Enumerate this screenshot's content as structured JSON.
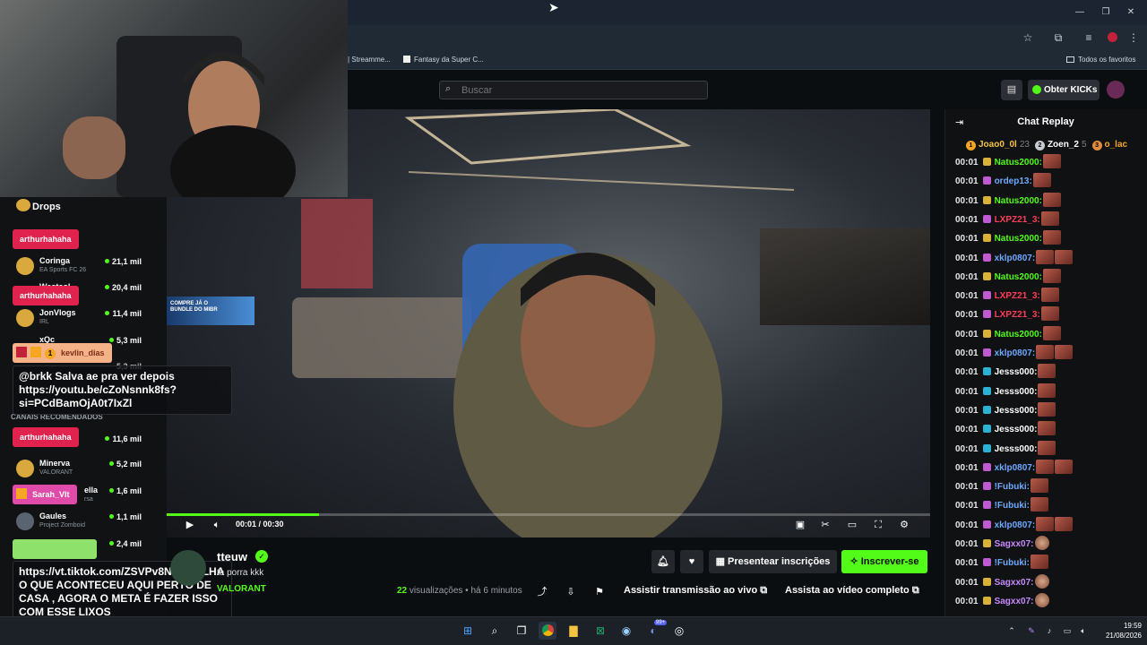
{
  "browser": {
    "bookmarks": [
      {
        "label": "| Streamme..."
      },
      {
        "label": "Fantasy da Super C..."
      }
    ],
    "bookmarks_folder": "Todos os favoritos"
  },
  "header": {
    "search_placeholder": "Buscar",
    "kicks_button": "Obter KICKs"
  },
  "sidebar": {
    "drops_label": "Drops",
    "section_recommended": "CANAIS RECOMENDADOS",
    "channels": [
      {
        "name": "Coringa",
        "category": "EA Sports FC 26",
        "viewers": "21,1 mil"
      },
      {
        "name": "Westcol",
        "category": "",
        "viewers": "20,4 mil"
      },
      {
        "name": "JonVlogs",
        "category": "IRL",
        "viewers": "11,4 mil"
      },
      {
        "name": "xQc",
        "category": "",
        "viewers": "5,3 mil"
      },
      {
        "name": "",
        "category": "",
        "viewers": "5,3 mil"
      },
      {
        "name": "",
        "category": "",
        "viewers": "11,6 mil"
      },
      {
        "name": "Minerva",
        "category": "VALORANT",
        "viewers": "5,2 mil"
      },
      {
        "name": "ella",
        "category": "rsa",
        "viewers": "1,6 mil"
      },
      {
        "name": "Gaules",
        "category": "Project Zomboid",
        "viewers": "1,1 mil"
      },
      {
        "name": "",
        "category": "",
        "viewers": "2,4 mil"
      }
    ]
  },
  "overlay": {
    "tag1": "arthurhahaha",
    "tag2": "arthurhahaha",
    "tag3": "kevlin_dias",
    "tag3_badge": "1",
    "msg1": "@brkk Salva ae pra ver depois https://youtu.be/cZoNsnnk8fs?si=PCdBamOjA0t7IxZl",
    "tag4": "arthurhahaha",
    "tag5": "Sarah_Vlt",
    "msg2": "https://vt.tiktok.com/ZSVPv8NQN/ OLHA O QUE ACONTECEU AQUI PERTO DE CASA , AGORA O META É FAZER ISSO COM ESSE LIXOS",
    "banner": "COMPRE JÁ O BUNDLE DO MIBR"
  },
  "video": {
    "timecode": "00:01 / 00:30",
    "progress_fraction": 0.2
  },
  "info": {
    "channel": "tteuw",
    "title": "ta porra kkk",
    "category": "VALORANT",
    "views_count": "22",
    "views_label": "visualizações",
    "time_ago": "há 6 minutos",
    "gift_button": "Presentear inscrições",
    "subscribe_button": "Inscrever-se",
    "watch_live": "Assistir transmissão ao vivo",
    "watch_full": "Assista ao vídeo completo"
  },
  "chat": {
    "title": "Chat Replay",
    "leaderboard": [
      {
        "rank": "1",
        "name": "Joao0_0l",
        "count": "23",
        "color": "#f5a623"
      },
      {
        "rank": "2",
        "name": "Zoen_2",
        "count": "5",
        "color": "#c7cbd1"
      },
      {
        "rank": "3",
        "name": "o_lac",
        "count": "",
        "color": "#e08a3c"
      }
    ],
    "messages": [
      {
        "t": "00:01",
        "user": "Natus2000:",
        "color": "#53fc18",
        "badge": "#d9b23a",
        "emotes": 1
      },
      {
        "t": "00:01",
        "user": "ordep13:",
        "color": "#6fa8ff",
        "badge": "#c05ad0",
        "emotes": 1
      },
      {
        "t": "00:01",
        "user": "Natus2000:",
        "color": "#53fc18",
        "badge": "#d9b23a",
        "emotes": 1
      },
      {
        "t": "00:01",
        "user": "LXPZ21_3:",
        "color": "#ff3d5a",
        "badge": "#c05ad0",
        "emotes": 1
      },
      {
        "t": "00:01",
        "user": "Natus2000:",
        "color": "#53fc18",
        "badge": "#d9b23a",
        "emotes": 1
      },
      {
        "t": "00:01",
        "user": "xklp0807:",
        "color": "#6fa8ff",
        "badge": "#c05ad0",
        "emotes": 2
      },
      {
        "t": "00:01",
        "user": "Natus2000:",
        "color": "#53fc18",
        "badge": "#d9b23a",
        "emotes": 1
      },
      {
        "t": "00:01",
        "user": "LXPZ21_3:",
        "color": "#ff3d5a",
        "badge": "#c05ad0",
        "emotes": 1
      },
      {
        "t": "00:01",
        "user": "LXPZ21_3:",
        "color": "#ff3d5a",
        "badge": "#c05ad0",
        "emotes": 1
      },
      {
        "t": "00:01",
        "user": "Natus2000:",
        "color": "#53fc18",
        "badge": "#d9b23a",
        "emotes": 1
      },
      {
        "t": "00:01",
        "user": "xklp0807:",
        "color": "#6fa8ff",
        "badge": "#c05ad0",
        "emotes": 2
      },
      {
        "t": "00:01",
        "user": "Jesss000:",
        "color": "#ffffff",
        "badge": "#2bb3d6",
        "emotes": 1
      },
      {
        "t": "00:01",
        "user": "Jesss000:",
        "color": "#ffffff",
        "badge": "#2bb3d6",
        "emotes": 1
      },
      {
        "t": "00:01",
        "user": "Jesss000:",
        "color": "#ffffff",
        "badge": "#2bb3d6",
        "emotes": 1
      },
      {
        "t": "00:01",
        "user": "Jesss000:",
        "color": "#ffffff",
        "badge": "#2bb3d6",
        "emotes": 1
      },
      {
        "t": "00:01",
        "user": "Jesss000:",
        "color": "#ffffff",
        "badge": "#2bb3d6",
        "emotes": 1
      },
      {
        "t": "00:01",
        "user": "xklp0807:",
        "color": "#6fa8ff",
        "badge": "#c05ad0",
        "emotes": 2
      },
      {
        "t": "00:01",
        "user": "!Fubuki:",
        "color": "#6fa8ff",
        "badge": "#c05ad0",
        "emotes": 1
      },
      {
        "t": "00:01",
        "user": "!Fubuki:",
        "color": "#6fa8ff",
        "badge": "#c05ad0",
        "emotes": 1
      },
      {
        "t": "00:01",
        "user": "xklp0807:",
        "color": "#6fa8ff",
        "badge": "#c05ad0",
        "emotes": 2
      },
      {
        "t": "00:01",
        "user": "Sagxx07:",
        "color": "#c58cff",
        "badge": "#d9b23a",
        "emotes": 1,
        "face": true
      },
      {
        "t": "00:01",
        "user": "!Fubuki:",
        "color": "#6fa8ff",
        "badge": "#c05ad0",
        "emotes": 1
      },
      {
        "t": "00:01",
        "user": "Sagxx07:",
        "color": "#c58cff",
        "badge": "#d9b23a",
        "emotes": 1,
        "face": true
      },
      {
        "t": "00:01",
        "user": "Sagxx07:",
        "color": "#c58cff",
        "badge": "#d9b23a",
        "emotes": 1,
        "face": true
      }
    ]
  },
  "taskbar": {
    "time": "19:59",
    "date": "21/08/2026",
    "notif_badge": "99+"
  },
  "colors": {
    "accent": "#53fc18",
    "background": "#0b0e11"
  }
}
